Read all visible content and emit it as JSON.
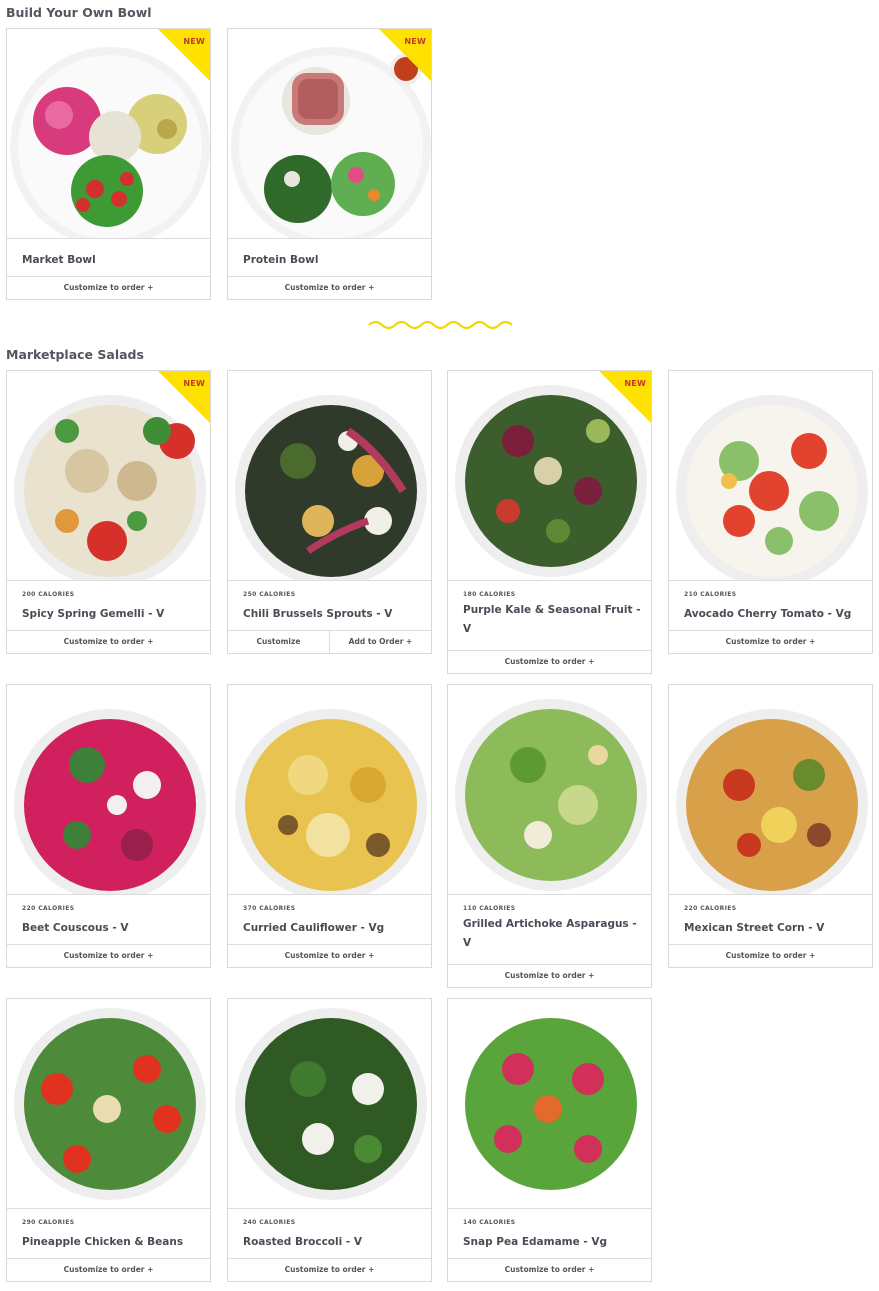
{
  "sections": {
    "build": {
      "title": "Build Your Own Bowl"
    },
    "salads": {
      "title": "Marketplace Salads"
    }
  },
  "badge_text": "NEW",
  "colors": {
    "badge": "#ffe100",
    "badge_text": "#c0392b",
    "divider": "#f2d600"
  },
  "build_items": [
    {
      "name": "Market Bowl",
      "action": "Customize to order +",
      "badge": true
    },
    {
      "name": "Protein Bowl",
      "action": "Customize to order +",
      "badge": true
    }
  ],
  "salads": [
    {
      "calories": "200 CALORIES",
      "name": "Spicy Spring Gemelli - V",
      "action": "Customize to order +",
      "badge": true
    },
    {
      "calories": "250 CALORIES",
      "name": "Chili Brussels Sprouts - V",
      "action_left": "Customize",
      "action_right": "Add to Order +"
    },
    {
      "calories": "180 CALORIES",
      "name": "Purple Kale & Seasonal Fruit - V",
      "action": "Customize to order +",
      "badge": true
    },
    {
      "calories": "210 CALORIES",
      "name": "Avocado Cherry Tomato - Vg",
      "action": "Customize to order +"
    },
    {
      "calories": "220 CALORIES",
      "name": "Beet Couscous - V",
      "action": "Customize to order +"
    },
    {
      "calories": "370 CALORIES",
      "name": "Curried Cauliflower - Vg",
      "action": "Customize to order +"
    },
    {
      "calories": "110 CALORIES",
      "name": "Grilled Artichoke Asparagus - V",
      "action": "Customize to order +"
    },
    {
      "calories": "220 CALORIES",
      "name": "Mexican Street Corn - V",
      "action": "Customize to order +"
    },
    {
      "calories": "290 CALORIES",
      "name": "Pineapple Chicken & Beans",
      "action": "Customize to order +"
    },
    {
      "calories": "240 CALORIES",
      "name": "Roasted Broccoli - V",
      "action": "Customize to order +"
    },
    {
      "calories": "140 CALORIES",
      "name": "Snap Pea Edamame - Vg",
      "action": "Customize to order +"
    }
  ]
}
